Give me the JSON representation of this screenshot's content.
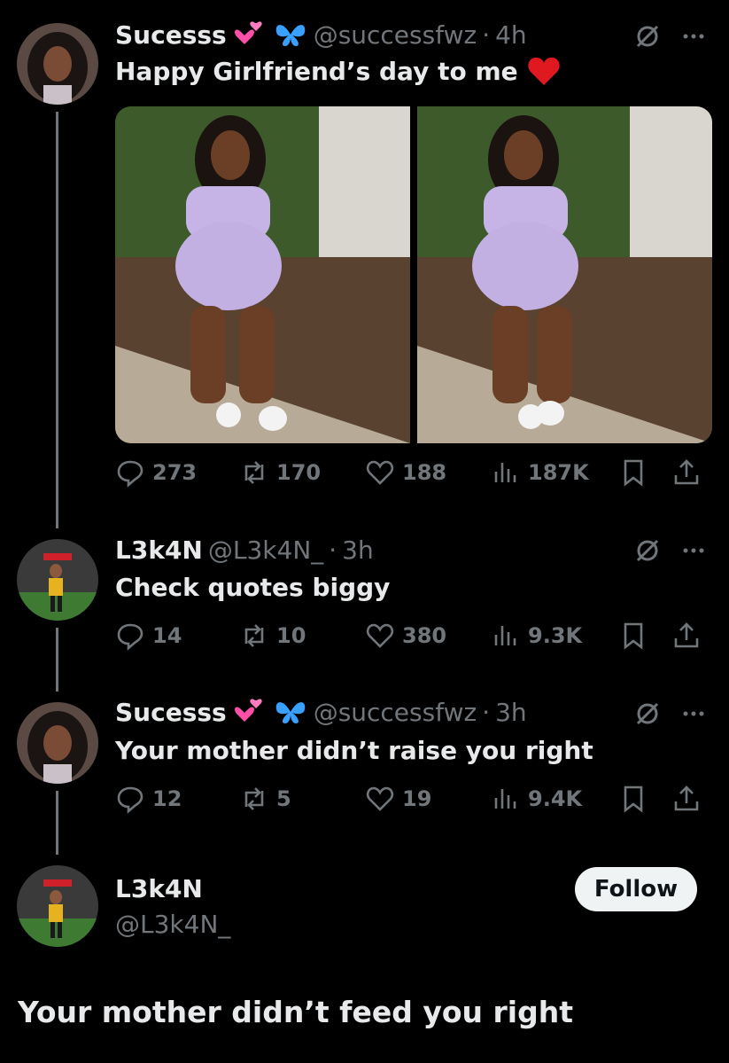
{
  "colors": {
    "background": "#000000",
    "text": "#e7e9ea",
    "muted": "#71767b",
    "heart": "#f91880",
    "heart_emoji": "#e0181f",
    "butterfly": "#1d9bf0"
  },
  "tweets": [
    {
      "name": "Sucesss",
      "handle": "@successfwz",
      "time": "4h",
      "text": "Happy Girlfriend’s day to me",
      "emoji_after_text": "red-heart",
      "has_media": true,
      "stats": {
        "replies": "273",
        "reposts": "170",
        "likes": "188",
        "views": "187K"
      }
    },
    {
      "name": "L3k4N",
      "handle": "@L3k4N_",
      "time": "3h",
      "text": "Check quotes biggy",
      "stats": {
        "replies": "14",
        "reposts": "10",
        "likes": "380",
        "views": "9.3K"
      }
    },
    {
      "name": "Sucesss",
      "handle": "@successfwz",
      "time": "3h",
      "text": "Your mother didn’t raise you right",
      "stats": {
        "replies": "12",
        "reposts": "5",
        "likes": "19",
        "views": "9.4K"
      }
    }
  ],
  "focused": {
    "name": "L3k4N",
    "handle": "@L3k4N_",
    "follow_label": "Follow",
    "text": "Your mother didn’t feed you right"
  },
  "separator": "·"
}
